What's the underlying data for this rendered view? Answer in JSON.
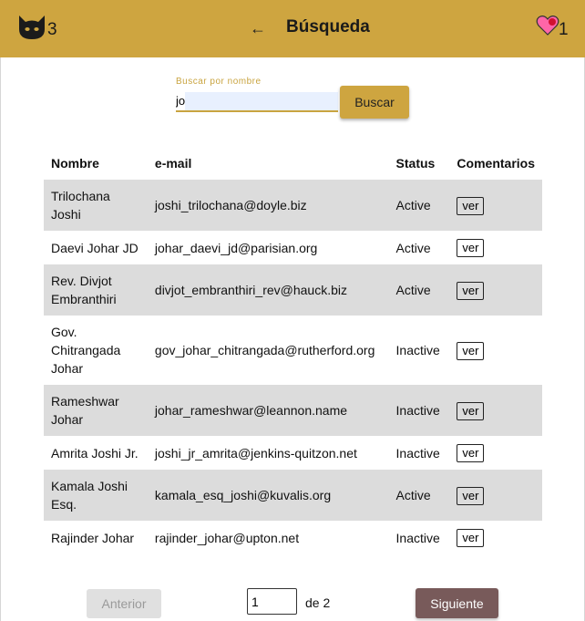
{
  "header": {
    "cat_count": "3",
    "back_label": "←",
    "title": "Búsqueda",
    "heart_count": "1",
    "bar_color": "#cea540"
  },
  "search": {
    "label": "Buscar por nombre",
    "value": "jo",
    "button_label": "Buscar"
  },
  "table": {
    "headers": [
      "Nombre",
      "e-mail",
      "Status",
      "Comentarios"
    ],
    "rows": [
      {
        "name": "Trilochana Joshi",
        "email": "joshi_trilochana@doyle.biz",
        "status": "Active",
        "action": "ver"
      },
      {
        "name": "Daevi Johar JD",
        "email": "johar_daevi_jd@parisian.org",
        "status": "Active",
        "action": "ver"
      },
      {
        "name": "Rev. Divjot Embranthiri",
        "email": "divjot_embranthiri_rev@hauck.biz",
        "status": "Active",
        "action": "ver"
      },
      {
        "name": "Gov. Chitrangada Johar",
        "email": "gov_johar_chitrangada@rutherford.org",
        "status": "Inactive",
        "action": "ver"
      },
      {
        "name": "Rameshwar Johar",
        "email": "johar_rameshwar@leannon.name",
        "status": "Inactive",
        "action": "ver"
      },
      {
        "name": "Amrita Joshi Jr.",
        "email": "joshi_jr_amrita@jenkins-quitzon.net",
        "status": "Inactive",
        "action": "ver"
      },
      {
        "name": "Kamala Joshi Esq.",
        "email": "kamala_esq_joshi@kuvalis.org",
        "status": "Active",
        "action": "ver"
      },
      {
        "name": "Rajinder Johar",
        "email": "rajinder_johar@upton.net",
        "status": "Inactive",
        "action": "ver"
      }
    ]
  },
  "pagination": {
    "prev_label": "Anterior",
    "page_value": "1",
    "of_label": "de 2",
    "next_label": "Siguiente"
  }
}
